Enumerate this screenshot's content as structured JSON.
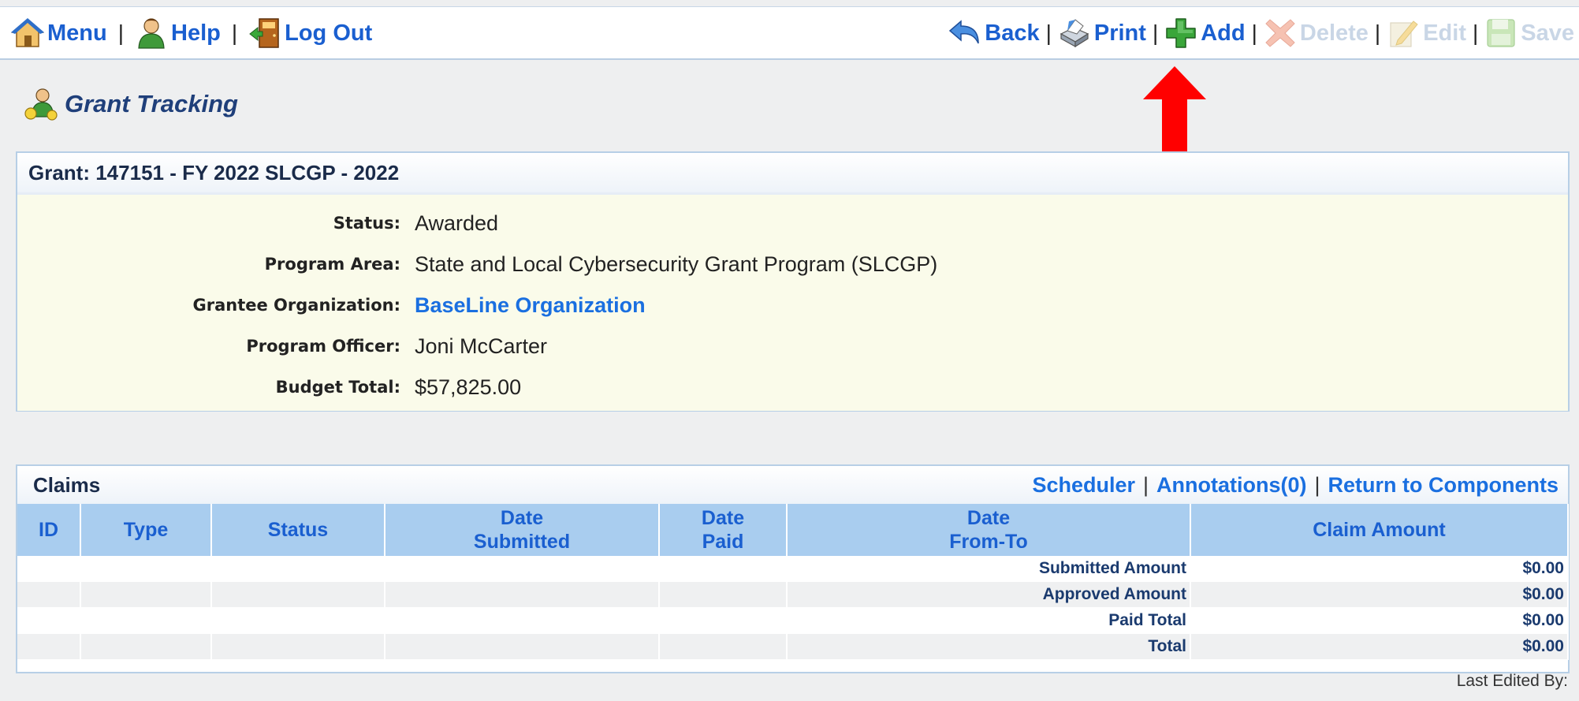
{
  "toolbar": {
    "menu": "Menu",
    "help": "Help",
    "logout": "Log Out",
    "back": "Back",
    "print": "Print",
    "add": "Add",
    "delete": "Delete",
    "edit": "Edit",
    "save": "Save",
    "separator": "|"
  },
  "page": {
    "title": "Grant Tracking"
  },
  "grant": {
    "header": "Grant: 147151 - FY 2022 SLCGP - 2022",
    "fields": [
      {
        "label": "Status:",
        "value": "Awarded"
      },
      {
        "label": "Program Area:",
        "value": "State and Local Cybersecurity Grant Program (SLCGP)"
      },
      {
        "label": "Grantee Organization:",
        "value": "BaseLine Organization"
      },
      {
        "label": "Program Officer:",
        "value": "Joni McCarter"
      },
      {
        "label": "Budget Total:",
        "value": "$57,825.00"
      }
    ]
  },
  "claims": {
    "title": "Claims",
    "links": {
      "scheduler": "Scheduler",
      "annotations": "Annotations(0)",
      "return": "Return to Components"
    },
    "columns": {
      "id": "ID",
      "type": "Type",
      "status": "Status",
      "date_submitted_1": "Date",
      "date_submitted_2": "Submitted",
      "date_paid_1": "Date",
      "date_paid_2": "Paid",
      "date_range_1": "Date",
      "date_range_2": "From-To",
      "claim_amount": "Claim Amount"
    },
    "totals": [
      {
        "label": "Submitted Amount",
        "value": "$0.00"
      },
      {
        "label": "Approved Amount",
        "value": "$0.00"
      },
      {
        "label": "Paid Total",
        "value": "$0.00"
      },
      {
        "label": "Total",
        "value": "$0.00"
      }
    ]
  },
  "footer": {
    "last_edited": "Last Edited By:"
  },
  "colors": {
    "link": "#1a6fe0",
    "header_bg": "#a9cdef",
    "arrow": "#ff0000",
    "grant_body_bg": "#fafbea"
  },
  "icons": {
    "menu": "home-icon",
    "help": "help-person-icon",
    "logout": "logout-door-icon",
    "back": "back-arrow-icon",
    "print": "printer-icon",
    "add": "add-cross-icon",
    "delete": "delete-x-icon",
    "edit": "edit-pencil-icon",
    "save": "save-disk-icon",
    "title": "grant-tracking-icon"
  }
}
